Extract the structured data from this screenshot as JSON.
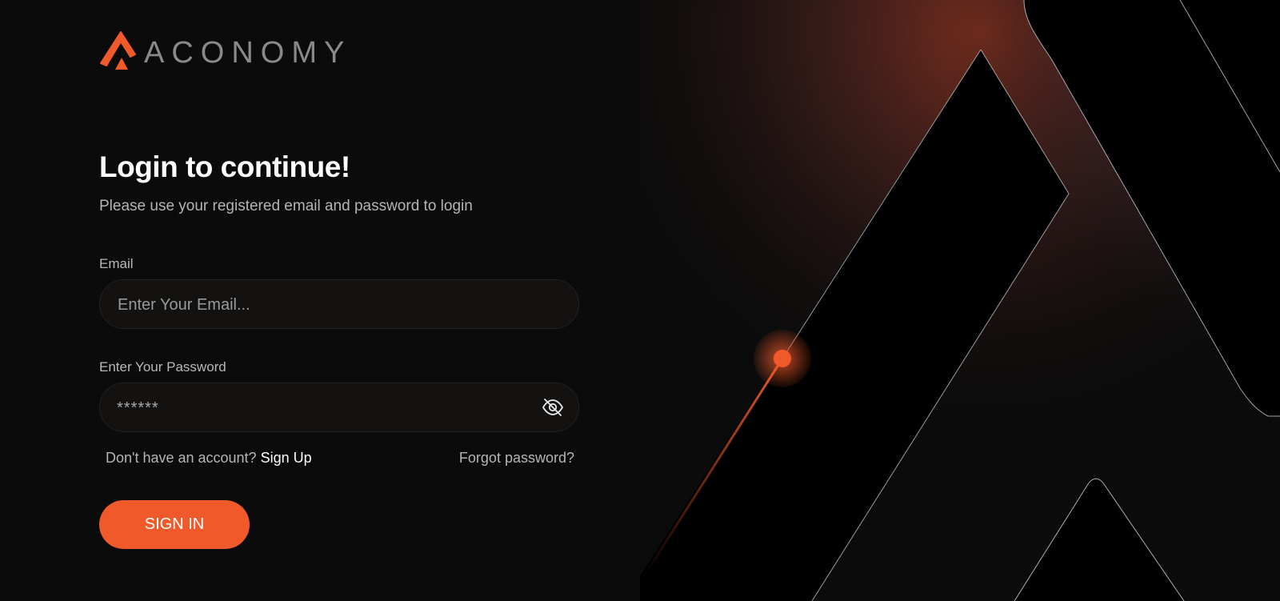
{
  "brand": {
    "name": "ACONOMY",
    "accent": "#f05a2b"
  },
  "login": {
    "title": "Login to continue!",
    "subtitle": "Please use your registered email and password to login",
    "email": {
      "label": "Email",
      "placeholder": "Enter Your Email...",
      "value": ""
    },
    "password": {
      "label": "Enter Your Password",
      "value": "******",
      "toggle_icon": "eye-slash-icon"
    },
    "signup_prompt": "Don't have an account?",
    "signup_link": "Sign Up",
    "forgot_link": "Forgot password?",
    "submit_label": "SIGN IN"
  },
  "colors": {
    "background": "#0b0b0b",
    "field_bg": "#131211",
    "text_primary": "#ffffff",
    "text_muted": "#b5b5b5"
  }
}
